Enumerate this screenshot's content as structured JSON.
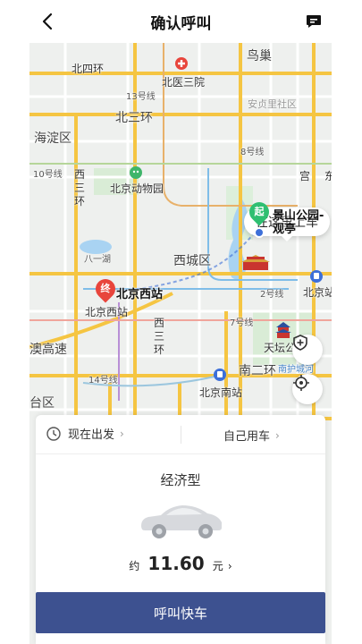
{
  "header": {
    "title": "确认呼叫"
  },
  "map": {
    "labels": {
      "niaochao": "鸟巢",
      "beisihuan": "北四环",
      "beiyisanyuan": "北医三院",
      "line13": "13号线",
      "anzhenli": "安贞里社区",
      "beisanhuan": "北三环",
      "haidian": "海淀区",
      "line8": "8号线",
      "line10": "10号线",
      "xisanhuan": "西三环",
      "zoo": "北京动物园",
      "gong": "宫",
      "bayi": "八一湖",
      "xicheng": "西城区",
      "beijingxi": "北京西站",
      "beijingxi_sub": "北京西站",
      "line2": "2号线",
      "beijingzhan": "北京站",
      "line7": "7号线",
      "aogaosu": "澳高速",
      "xisan2": "西三环",
      "tiantan": "天坛公",
      "nanerhuan": "南二环",
      "nanhucheng": "南护城河",
      "line14": "14号线",
      "beijingnan": "北京南站",
      "taiqu": "台区",
      "dong": "东",
      "jingshan": "景山公园-观亭"
    },
    "pickup_bubble": "在这里上车",
    "start_marker": "起",
    "end_marker": "终",
    "colors": {
      "ring_road": "#f5c542",
      "start": "#2fbf71",
      "end": "#e8453c"
    }
  },
  "panel": {
    "depart_time": "现在出发",
    "self_use": "自己用车",
    "car_type": "经济型",
    "price_prefix": "约",
    "price": "11.60",
    "price_unit": "元",
    "call_button": "呼叫快车"
  }
}
